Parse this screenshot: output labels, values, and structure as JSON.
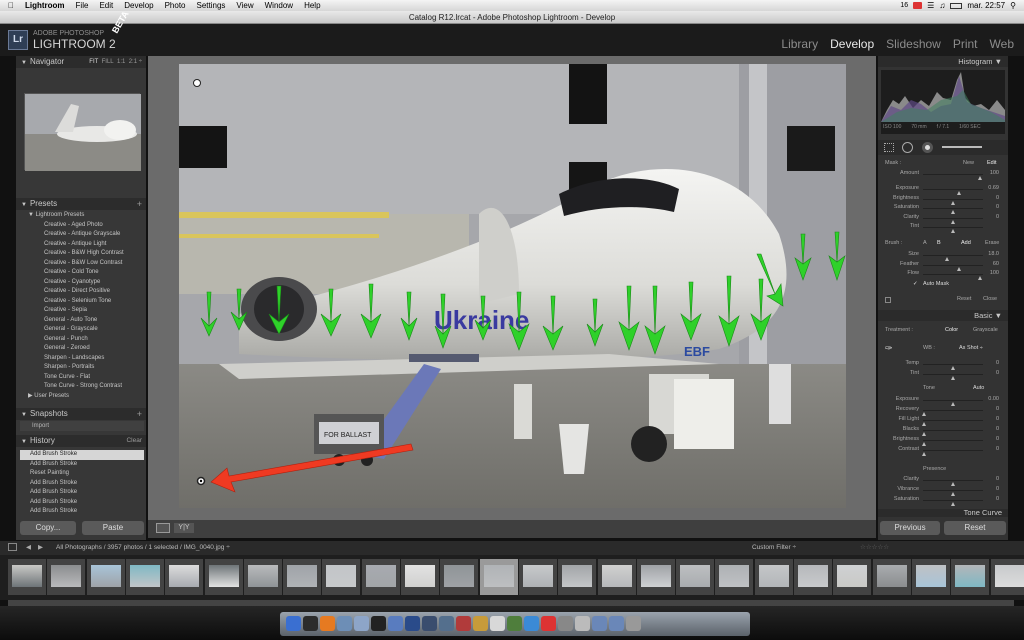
{
  "menubar": {
    "app_name": "Lightroom",
    "items": [
      "File",
      "Edit",
      "Develop",
      "Photo",
      "Settings",
      "View",
      "Window",
      "Help"
    ],
    "status": {
      "badge_count": "16",
      "clock": "mar. 22:57"
    }
  },
  "window": {
    "title": "Catalog R12.lrcat - Adobe Photoshop Lightroom - Develop"
  },
  "brand": {
    "logo": "Lr",
    "line1": "ADOBE PHOTOSHOP",
    "line2": "LIGHTROOM 2",
    "beta": "BETA"
  },
  "modules": [
    "Library",
    "Develop",
    "Slideshow",
    "Print",
    "Web"
  ],
  "left": {
    "navigator": {
      "title": "Navigator",
      "zoom_options": [
        "FIT",
        "FILL",
        "1:1",
        "2:1 ÷"
      ]
    },
    "presets": {
      "title": "Presets",
      "lightroom_group": "Lightroom Presets",
      "items": [
        "Creative - Aged Photo",
        "Creative - Antique Grayscale",
        "Creative - Antique Light",
        "Creative - B&W High Contrast",
        "Creative - B&W Low Contrast",
        "Creative - Cold Tone",
        "Creative - Cyanotype",
        "Creative - Direct Positive",
        "Creative - Selenium Tone",
        "Creative - Sepia",
        "General - Auto Tone",
        "General - Grayscale",
        "General - Punch",
        "General - Zeroed",
        "Sharpen - Landscapes",
        "Sharpen - Portraits",
        "Tone Curve - Flat",
        "Tone Curve - Strong Contrast"
      ],
      "user_group": "User Presets"
    },
    "snapshots": {
      "title": "Snapshots",
      "items": [
        "Import"
      ]
    },
    "history": {
      "title": "History",
      "clear": "Clear",
      "items": [
        "Add Brush Stroke",
        "Add Brush Stroke",
        "Reset Painting",
        "Add Brush Stroke",
        "Add Brush Stroke",
        "Add Brush Stroke",
        "Add Brush Stroke"
      ]
    },
    "copy": "Copy...",
    "paste": "Paste"
  },
  "photo": {
    "gse_text": "FOR BALLAST",
    "tail_code": "EBF",
    "livery": "Ukraine"
  },
  "right": {
    "histogram": {
      "title": "Histogram",
      "iso": "ISO 100",
      "focal": "70 mm",
      "aperture": "f / 7.1",
      "shutter": "1/60 SEC"
    },
    "mask": {
      "label": "Mask :",
      "new": "New",
      "edit": "Edit"
    },
    "mask_sliders": [
      {
        "label": "Amount",
        "value": "100",
        "pos": 0.95
      }
    ],
    "effect_sliders": [
      {
        "label": "Exposure",
        "value": "0.69",
        "pos": 0.6
      },
      {
        "label": "Brightness",
        "value": "0",
        "pos": 0.5
      },
      {
        "label": "Saturation",
        "value": "0",
        "pos": 0.5
      },
      {
        "label": "Clarity",
        "value": "0",
        "pos": 0.5
      },
      {
        "label": "Tint",
        "value": "",
        "pos": 0.5
      }
    ],
    "brush": {
      "label": "Brush :",
      "a": "A",
      "b": "B",
      "add": "Add",
      "erase": "Erase"
    },
    "brush_sliders": [
      {
        "label": "Size",
        "value": "18.0",
        "pos": 0.4
      },
      {
        "label": "Feather",
        "value": "60",
        "pos": 0.6
      },
      {
        "label": "Flow",
        "value": "100",
        "pos": 0.95
      }
    ],
    "auto_mask": "Auto Mask",
    "brush_reset": "Reset",
    "brush_close": "Close",
    "basic": {
      "title": "Basic",
      "treatment": "Treatment :",
      "color": "Color",
      "grayscale": "Grayscale",
      "wb_label": "WB :",
      "wb_value": "As Shot ÷"
    },
    "wb_sliders": [
      {
        "label": "Temp",
        "value": "0",
        "pos": 0.5
      },
      {
        "label": "Tint",
        "value": "0",
        "pos": 0.5
      }
    ],
    "tone": {
      "label": "Tone",
      "auto": "Auto"
    },
    "tone_sliders": [
      {
        "label": "Exposure",
        "value": "0.00",
        "pos": 0.5
      },
      {
        "label": "Recovery",
        "value": "0",
        "pos": 0.02
      },
      {
        "label": "Fill Light",
        "value": "0",
        "pos": 0.02
      },
      {
        "label": "Blacks",
        "value": "0",
        "pos": 0.02
      },
      {
        "label": "Brightness",
        "value": "0",
        "pos": 0.02
      },
      {
        "label": "Contrast",
        "value": "0",
        "pos": 0.02
      }
    ],
    "presence": "Presence",
    "presence_sliders": [
      {
        "label": "Clarity",
        "value": "0",
        "pos": 0.5
      },
      {
        "label": "Vibrance",
        "value": "0",
        "pos": 0.5
      },
      {
        "label": "Saturation",
        "value": "0",
        "pos": 0.5
      }
    ],
    "tone_curve": "Tone Curve",
    "previous": "Previous",
    "reset": "Reset"
  },
  "filmstrip": {
    "path": "All Photographs / 3957 photos / 1 selected / IMG_0040.jpg ÷",
    "filter": "Custom Filter ÷"
  },
  "colors": {
    "arrow_green": "#2fd12a",
    "arrow_red": "#ef3a22",
    "panel": "#373737",
    "center_bg": "#6b6b6b"
  }
}
